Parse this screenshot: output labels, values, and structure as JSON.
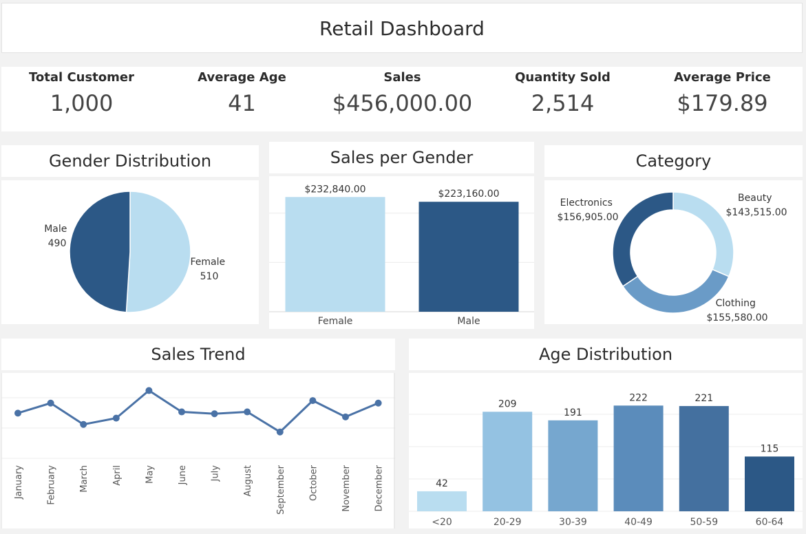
{
  "header": {
    "title": "Retail Dashboard"
  },
  "kpis": [
    {
      "label": "Total Customer",
      "value": "1,000"
    },
    {
      "label": "Average Age",
      "value": "41"
    },
    {
      "label": "Sales",
      "value": "$456,000.00"
    },
    {
      "label": "Quantity Sold",
      "value": "2,514"
    },
    {
      "label": "Average Price",
      "value": "$179.89"
    }
  ],
  "colors": {
    "light": "#b9ddf0",
    "dark": "#2c5886",
    "mid": "#6a9bc7"
  },
  "chart_data": [
    {
      "id": "gender",
      "type": "pie",
      "title": "Gender Distribution",
      "slices": [
        {
          "label": "Female",
          "value": 510,
          "value_label": "510",
          "color": "#b9ddf0"
        },
        {
          "label": "Male",
          "value": 490,
          "value_label": "490",
          "color": "#2c5886"
        }
      ]
    },
    {
      "id": "sales_gender",
      "type": "bar",
      "title": "Sales per Gender",
      "categories": [
        "Female",
        "Male"
      ],
      "values": [
        232840,
        223160
      ],
      "value_labels": [
        "$232,840.00",
        "$223,160.00"
      ],
      "colors": [
        "#b9ddf0",
        "#2c5886"
      ],
      "ylim": [
        0,
        250000
      ],
      "grid": true
    },
    {
      "id": "category",
      "type": "pie",
      "title": "Category",
      "slices": [
        {
          "label": "Beauty",
          "value": 143515,
          "value_label": "$143,515.00",
          "color": "#b9ddf0"
        },
        {
          "label": "Clothing",
          "value": 155580,
          "value_label": "$155,580.00",
          "color": "#6a9bc7"
        },
        {
          "label": "Electronics",
          "value": 156905,
          "value_label": "$156,905.00",
          "color": "#2c5886"
        }
      ]
    },
    {
      "id": "trend",
      "type": "line",
      "title": "Sales Trend",
      "categories": [
        "January",
        "February",
        "March",
        "April",
        "May",
        "June",
        "July",
        "August",
        "September",
        "October",
        "November",
        "December"
      ],
      "values": [
        36000,
        44000,
        27000,
        32000,
        54000,
        37000,
        35500,
        37000,
        21000,
        46000,
        33000,
        44000
      ],
      "ylim": [
        0,
        68000
      ],
      "grid": true
    },
    {
      "id": "age",
      "type": "bar",
      "title": "Age Distribution",
      "categories": [
        "<20",
        "20-29",
        "30-39",
        "40-49",
        "50-59",
        "60-64"
      ],
      "values": [
        42,
        209,
        191,
        222,
        221,
        115
      ],
      "value_labels": [
        "42",
        "209",
        "191",
        "222",
        "221",
        "115"
      ],
      "colors": [
        "#b9ddf0",
        "#94c2e2",
        "#76a7cf",
        "#5b8cbb",
        "#44709f",
        "#2c5886"
      ],
      "ylim": [
        0,
        250
      ],
      "grid": true
    }
  ]
}
